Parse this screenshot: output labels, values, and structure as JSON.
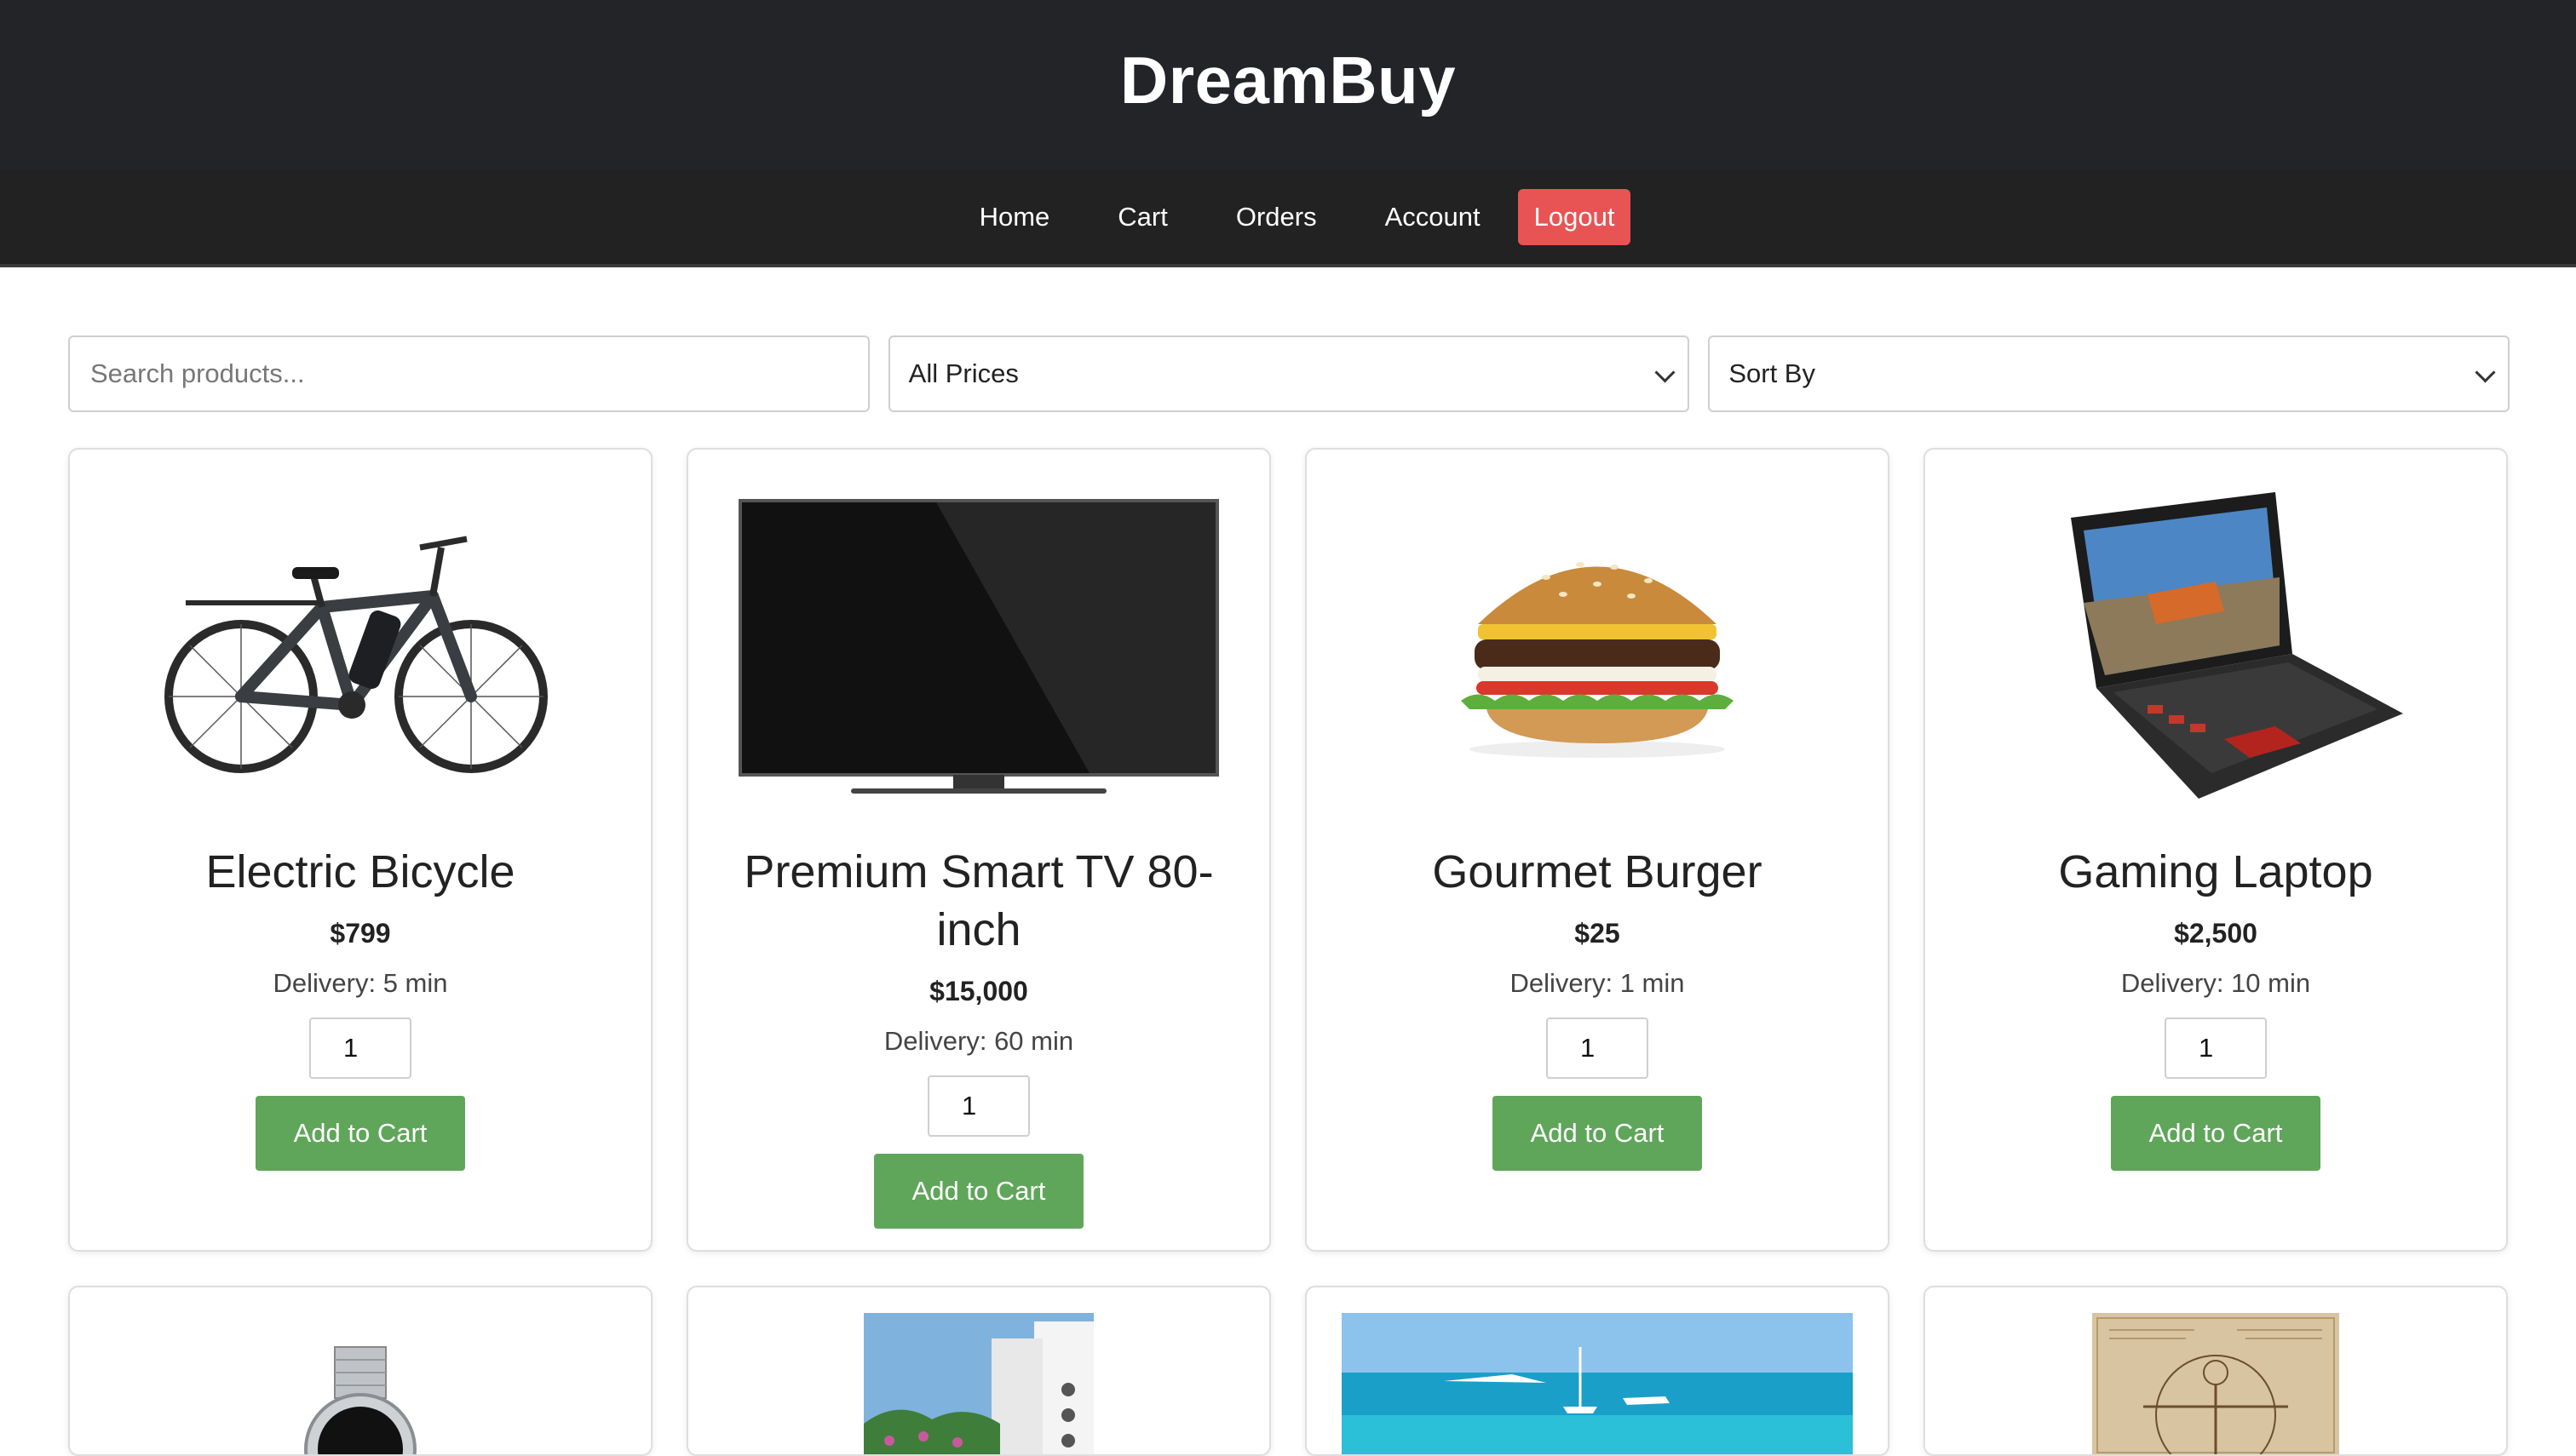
{
  "brand": {
    "name": "DreamBuy"
  },
  "nav": {
    "home": "Home",
    "cart": "Cart",
    "orders": "Orders",
    "account": "Account",
    "logout": "Logout",
    "logout_color": "#e85454"
  },
  "filters": {
    "search_placeholder": "Search products...",
    "price_selected": "All Prices",
    "sort_selected": "Sort By"
  },
  "products": [
    {
      "name": "Electric Bicycle",
      "price": "$799",
      "delivery": "Delivery: 5 min",
      "qty": "1",
      "button": "Add to Cart",
      "icon": "bicycle-image"
    },
    {
      "name": "Premium Smart TV 80-inch",
      "price": "$15,000",
      "delivery": "Delivery: 60 min",
      "qty": "1",
      "button": "Add to Cart",
      "icon": "tv-image"
    },
    {
      "name": "Gourmet Burger",
      "price": "$25",
      "delivery": "Delivery: 1 min",
      "qty": "1",
      "button": "Add to Cart",
      "icon": "burger-image"
    },
    {
      "name": "Gaming Laptop",
      "price": "$2,500",
      "delivery": "Delivery: 10 min",
      "qty": "1",
      "button": "Add to Cart",
      "icon": "laptop-image"
    }
  ],
  "more_products_icons": [
    "watch-image",
    "villa-image",
    "yacht-sea-image",
    "vitruvian-man-image"
  ],
  "colors": {
    "header_bg": "#222428",
    "nav_bg": "#222222",
    "button_green": "#5fa65a"
  }
}
